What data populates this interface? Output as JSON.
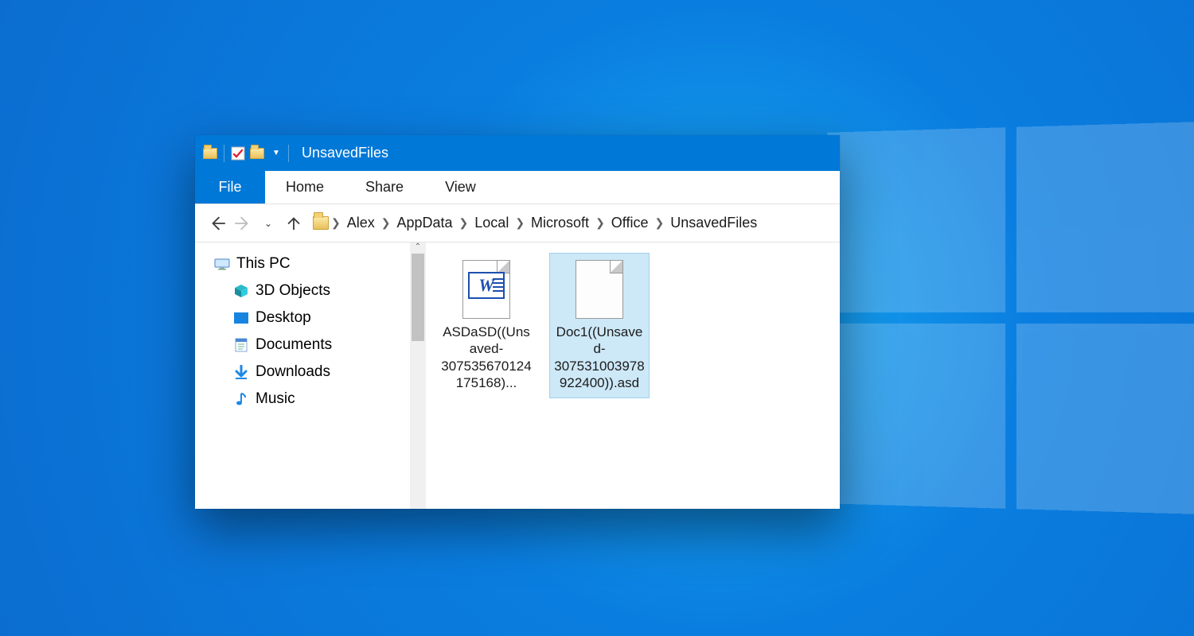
{
  "titlebar": {
    "title": "UnsavedFiles"
  },
  "ribbon": {
    "file": "File",
    "tabs": [
      "Home",
      "Share",
      "View"
    ]
  },
  "breadcrumb": [
    "Alex",
    "AppData",
    "Local",
    "Microsoft",
    "Office",
    "UnsavedFiles"
  ],
  "navpane": {
    "root": "This PC",
    "items": [
      "3D Objects",
      "Desktop",
      "Documents",
      "Downloads",
      "Music"
    ]
  },
  "files": [
    {
      "name": "ASDaSD((Unsaved-307535670124175168)...",
      "type": "word",
      "selected": false
    },
    {
      "name": "Doc1((Unsaved-307531003978922400)).asd",
      "type": "blank",
      "selected": true
    }
  ]
}
